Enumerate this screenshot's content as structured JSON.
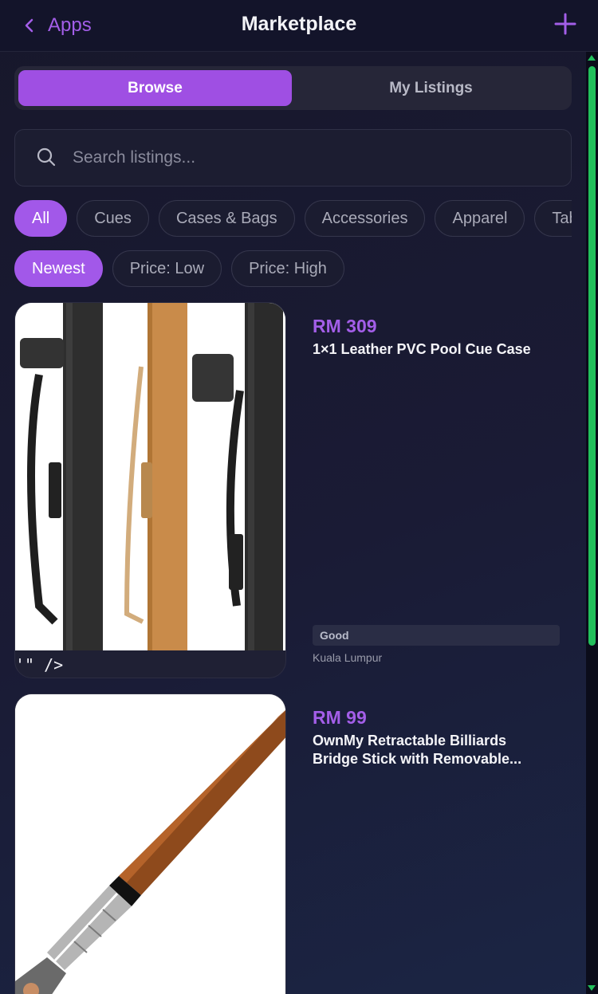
{
  "header": {
    "back_label": "Apps",
    "title": "Marketplace",
    "add_icon": "plus-icon"
  },
  "tabs": [
    {
      "label": "Browse",
      "active": true
    },
    {
      "label": "My Listings",
      "active": false
    }
  ],
  "search": {
    "placeholder": "Search listings...",
    "value": ""
  },
  "categories": [
    "All",
    "Cues",
    "Cases & Bags",
    "Accessories",
    "Apparel",
    "Tabl"
  ],
  "active_category": "All",
  "sort_options": [
    "Newest",
    "Price: Low",
    "Price: High"
  ],
  "active_sort": "Newest",
  "listings": [
    {
      "price": "RM 309",
      "name": "1×1 Leather PVC Pool Cue Case",
      "condition": "Good",
      "location": "Kuala Lumpur",
      "image_fallback_text": "'\" />"
    },
    {
      "price": "RM 99",
      "name": "OwnMy Retractable Billiards Bridge Stick with Removable..."
    }
  ],
  "colors": {
    "accent": "#a258e9",
    "scrollbar": "#22c05c",
    "background": "#17172b"
  }
}
